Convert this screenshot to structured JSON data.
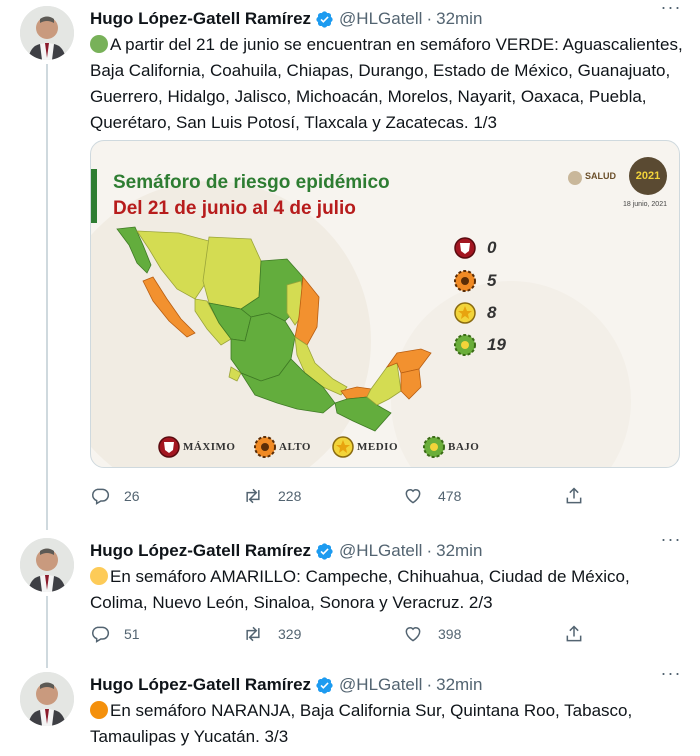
{
  "author": {
    "name": "Hugo López-Gatell Ramírez",
    "handle": "@HLGatell",
    "separator": "·"
  },
  "tweets": [
    {
      "time": "32min",
      "circle_color": "#78b159",
      "text": "A partir del 21 de junio se encuentran en semáforo VERDE: Aguascalientes, Baja California, Coahuila, Chiapas, Durango, Estado de México, Guanajuato, Guerrero, Hidalgo, Jalisco, Michoacán, Morelos, Nayarit, Oaxaca, Puebla, Querétaro, San Luis Potosí, Tlaxcala y Zacatecas. 1/3",
      "replies": "26",
      "retweets": "228",
      "likes": "478"
    },
    {
      "time": "32min",
      "circle_color": "#fdcb58",
      "text": "En semáforo AMARILLO: Campeche, Chihuahua, Ciudad de México, Colima, Nuevo León, Sinaloa, Sonora y Veracruz. 2/3",
      "replies": "51",
      "retweets": "329",
      "likes": "398"
    },
    {
      "time": "32min",
      "circle_color": "#f4900c",
      "text": "En semáforo NARANJA, Baja California Sur, Quintana Roo, Tabasco, Tamaulipas y Yucatán. 3/3"
    }
  ],
  "media": {
    "title": "Semáforo de riesgo epidémico",
    "subtitle": "Del 21 de junio al 4 de julio",
    "salud_label": "SALUD",
    "seal_year": "2021",
    "seal_date": "18 junio, 2021",
    "counts": {
      "maximo": "0",
      "alto": "5",
      "medio": "8",
      "bajo": "19"
    },
    "legend": {
      "maximo": "Máximo",
      "alto": "Alto",
      "medio": "Medio",
      "bajo": "Bajo"
    },
    "colors": {
      "maximo": "#a31621",
      "alto": "#f08a24",
      "medio": "#f2d43a",
      "bajo": "#6aae3a",
      "green_map": "#63ad3d",
      "yellow_map": "#d4dc52",
      "orange_map": "#f2912f"
    }
  }
}
